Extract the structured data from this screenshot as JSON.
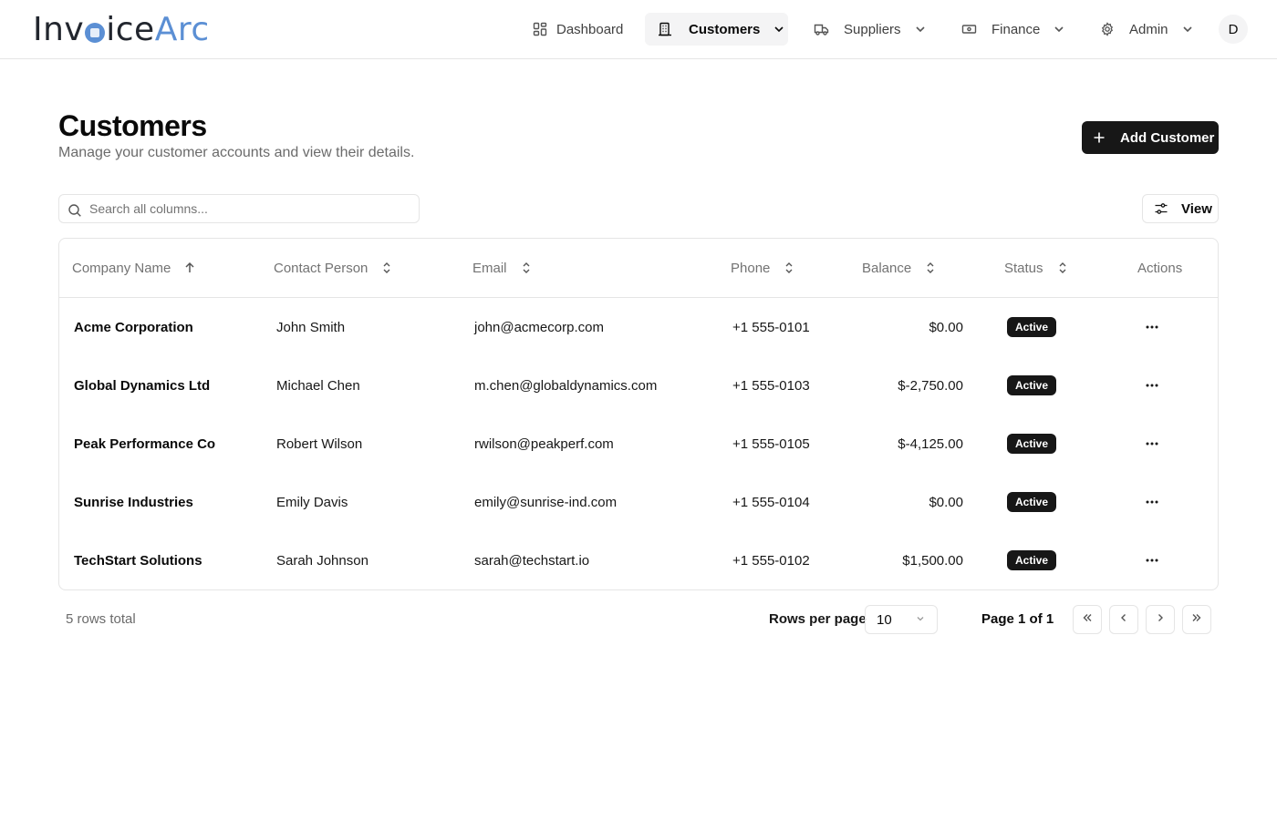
{
  "brand": {
    "part1": "Inv",
    "part2": "ice",
    "part3": "Arc"
  },
  "nav": [
    {
      "label": "Dashboard",
      "icon": "dashboard-icon",
      "has_dropdown": false,
      "active": false
    },
    {
      "label": "Customers",
      "icon": "building-icon",
      "has_dropdown": true,
      "active": true
    },
    {
      "label": "Suppliers",
      "icon": "truck-icon",
      "has_dropdown": true,
      "active": false
    },
    {
      "label": "Finance",
      "icon": "banknote-icon",
      "has_dropdown": true,
      "active": false
    },
    {
      "label": "Admin",
      "icon": "gear-icon",
      "has_dropdown": true,
      "active": false
    }
  ],
  "user": {
    "initial": "D"
  },
  "page": {
    "title": "Customers",
    "subtitle": "Manage your customer accounts and view their details.",
    "add_button": "Add Customer"
  },
  "toolbar": {
    "search_placeholder": "Search all columns...",
    "view_button": "View"
  },
  "table": {
    "columns": [
      {
        "label": "Company Name",
        "sort": "asc"
      },
      {
        "label": "Contact Person",
        "sort": "none"
      },
      {
        "label": "Email",
        "sort": "none"
      },
      {
        "label": "Phone",
        "sort": "none"
      },
      {
        "label": "Balance",
        "sort": "none"
      },
      {
        "label": "Status",
        "sort": "none"
      },
      {
        "label": "Actions",
        "sort": null
      }
    ],
    "rows": [
      {
        "company": "Acme Corporation",
        "contact": "John Smith",
        "email": "john@acmecorp.com",
        "phone": "+1 555-0101",
        "balance": "$0.00",
        "status": "Active"
      },
      {
        "company": "Global Dynamics Ltd",
        "contact": "Michael Chen",
        "email": "m.chen@globaldynamics.com",
        "phone": "+1 555-0103",
        "balance": "$-2,750.00",
        "status": "Active"
      },
      {
        "company": "Peak Performance Co",
        "contact": "Robert Wilson",
        "email": "rwilson@peakperf.com",
        "phone": "+1 555-0105",
        "balance": "$-4,125.00",
        "status": "Active"
      },
      {
        "company": "Sunrise Industries",
        "contact": "Emily Davis",
        "email": "emily@sunrise-ind.com",
        "phone": "+1 555-0104",
        "balance": "$0.00",
        "status": "Active"
      },
      {
        "company": "TechStart Solutions",
        "contact": "Sarah Johnson",
        "email": "sarah@techstart.io",
        "phone": "+1 555-0102",
        "balance": "$1,500.00",
        "status": "Active"
      }
    ]
  },
  "footer": {
    "rows_total": "5 rows total",
    "rows_per_page_label": "Rows per page",
    "rows_per_page_value": "10",
    "page_info": "Page 1 of 1"
  },
  "colors": {
    "primary": "#171717",
    "brand_blue": "#5b8fd4",
    "border": "#e5e5e5",
    "muted_text": "#737373"
  }
}
